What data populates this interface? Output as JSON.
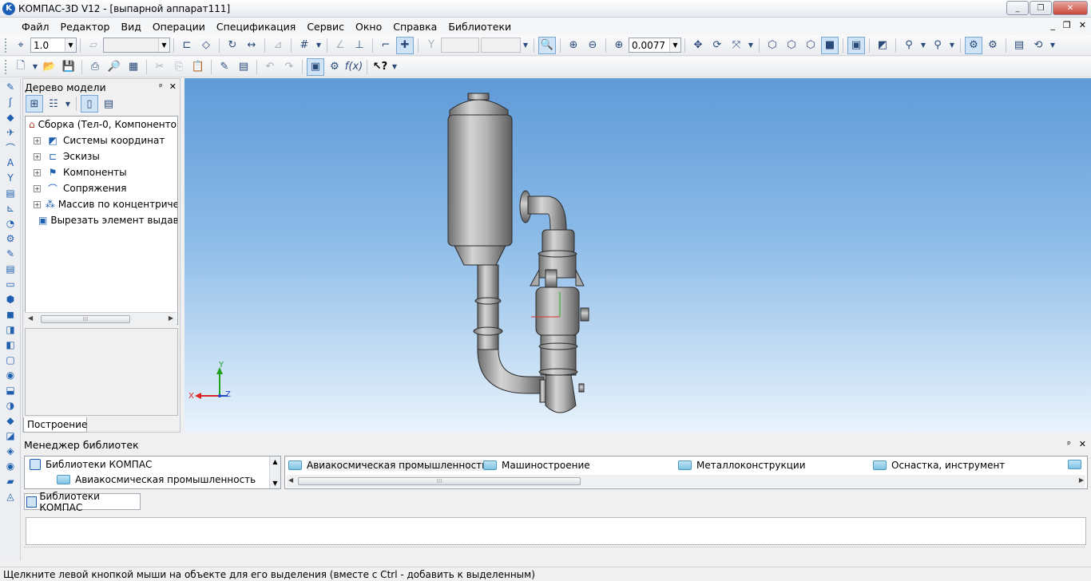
{
  "window": {
    "title": "КОМПАС-3D V12 - [выпарной аппарат111]",
    "controls": [
      "_",
      "❐",
      "✕"
    ]
  },
  "menu": {
    "items": [
      {
        "label": "Файл"
      },
      {
        "label": "Редактор"
      },
      {
        "label": "Вид"
      },
      {
        "label": "Операции"
      },
      {
        "label": "Спецификация"
      },
      {
        "label": "Сервис"
      },
      {
        "label": "Окно"
      },
      {
        "label": "Справка"
      },
      {
        "label": "Библиотеки"
      }
    ],
    "doc_controls": [
      "_",
      "❐",
      "✕"
    ]
  },
  "toolbar1": {
    "step_value": "1.0",
    "zoom_value": "0.0077"
  },
  "tree": {
    "title": "Дерево модели",
    "header_buttons": [
      "ᵖ",
      "✕"
    ],
    "root": "Сборка (Тел-0, Компонентов",
    "items": [
      {
        "label": "Системы координат",
        "icon": "coordinate-systems-icon"
      },
      {
        "label": "Эскизы",
        "icon": "sketches-icon"
      },
      {
        "label": "Компоненты",
        "icon": "components-icon"
      },
      {
        "label": "Сопряжения",
        "icon": "mates-icon"
      },
      {
        "label": "Массив по концентричес",
        "icon": "pattern-icon"
      },
      {
        "label": "Вырезать элемент выдав.",
        "icon": "extrude-cut-icon"
      }
    ],
    "tab": "Построение"
  },
  "triad": {
    "x": "X",
    "y": "Y",
    "z": "Z"
  },
  "library_manager": {
    "title": "Менеджер библиотек",
    "tree_root": "Библиотеки КОМПАС",
    "tree_child": "Авиакосмическая промышленность",
    "list": [
      {
        "label": "Авиакосмическая промышленность"
      },
      {
        "label": "Машиностроение"
      },
      {
        "label": "Металлоконструкции"
      },
      {
        "label": "Оснастка, инструмент"
      }
    ],
    "tab": "Библиотеки КОМПАС"
  },
  "status": {
    "text": "Щелкните левой кнопкой мыши на объекте для его выделения (вместе с Ctrl - добавить к выделенным)"
  }
}
